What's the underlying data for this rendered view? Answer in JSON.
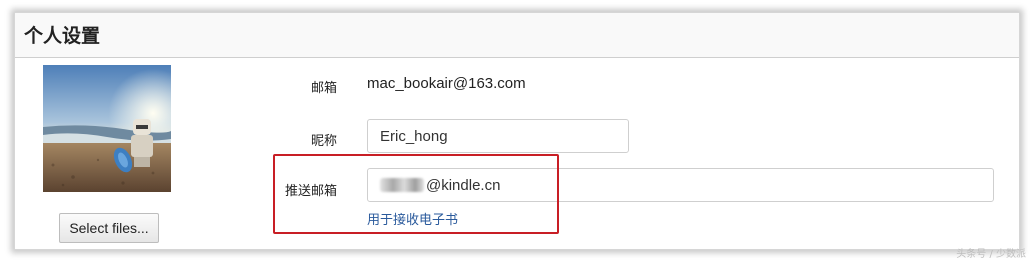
{
  "header": {
    "title": "个人设置"
  },
  "avatar": {
    "alt": "avatar photo"
  },
  "upload": {
    "button_label": "Select files..."
  },
  "fields": {
    "email": {
      "label": "邮箱",
      "value": "mac_bookair@163.com"
    },
    "nickname": {
      "label": "昵称",
      "value": "Eric_hong"
    },
    "push_email": {
      "label": "推送邮箱",
      "value_suffix": "@kindle.cn",
      "hint": "用于接收电子书"
    }
  },
  "watermark": "头条号 / 少数派",
  "colors": {
    "highlight": "#c81e25",
    "hint_link": "#2a5a9c"
  }
}
